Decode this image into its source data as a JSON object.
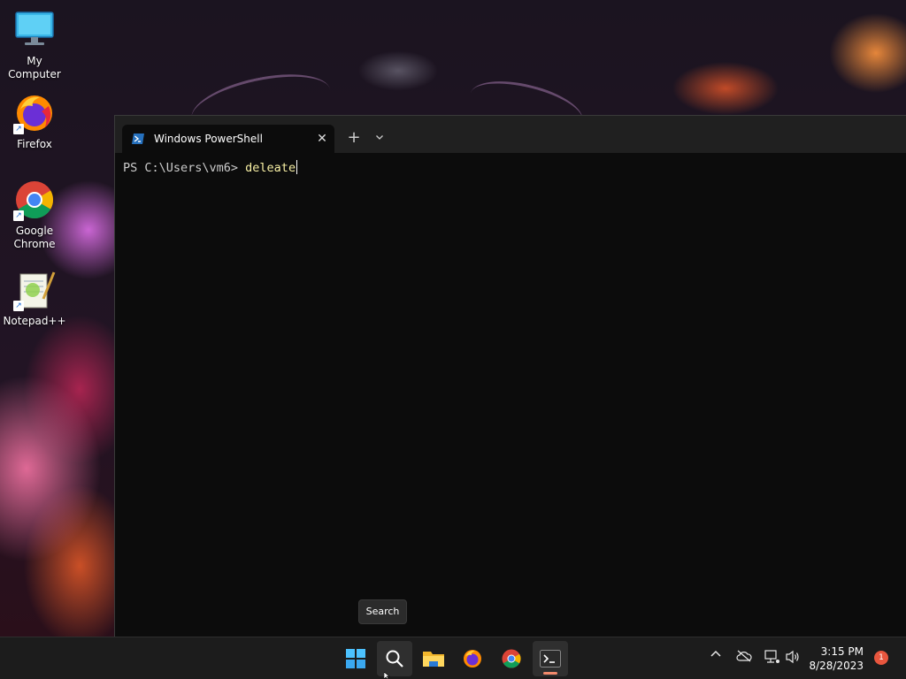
{
  "desktop": {
    "icons": [
      {
        "label": "My Computer",
        "icon": "monitor-icon"
      },
      {
        "label": "Firefox",
        "icon": "firefox-icon"
      },
      {
        "label": "Google Chrome",
        "icon": "chrome-icon"
      },
      {
        "label": "Notepad++",
        "icon": "notepadpp-icon"
      }
    ]
  },
  "terminal": {
    "tab_title": "Windows PowerShell",
    "close_glyph": "✕",
    "new_tab_glyph": "+",
    "dropdown_glyph": "⌄",
    "prompt": "PS C:\\Users\\vm6> ",
    "command": "deleate"
  },
  "tooltip": {
    "text": "Search"
  },
  "taskbar": {
    "apps": [
      "start-icon",
      "search-icon",
      "file-explorer-icon",
      "firefox-icon",
      "chrome-icon",
      "terminal-icon"
    ],
    "tray_chevron": "^",
    "clock_time": "3:15 PM",
    "clock_date": "8/28/2023",
    "notification_count": "1"
  },
  "colors": {
    "terminal_bg": "#0c0c0c",
    "command_text": "#f9f1a5",
    "taskbar_bg": "#1c1c1c",
    "badge": "#e8563e"
  }
}
